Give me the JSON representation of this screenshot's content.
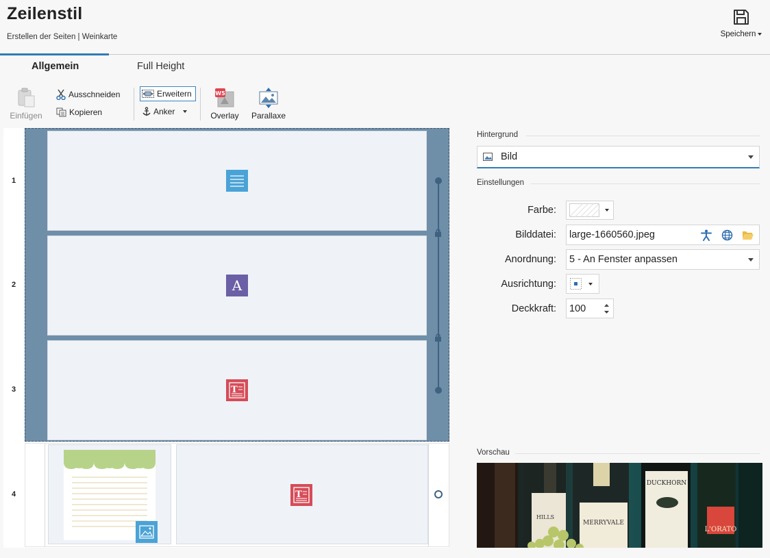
{
  "header": {
    "title": "Zeilenstil",
    "breadcrumb": "Erstellen der Seiten | Weinkarte",
    "save_label": "Speichern"
  },
  "tabs": [
    {
      "label": "Allgemein",
      "active": true
    },
    {
      "label": "Full Height",
      "active": false
    }
  ],
  "ribbon": {
    "paste": "Einfügen",
    "cut": "Ausschneiden",
    "copy": "Kopieren",
    "expand": "Erweitern",
    "anchor": "Anker",
    "overlay": "Overlay",
    "parallax": "Parallaxe"
  },
  "grid": {
    "rows": [
      {
        "number": "1",
        "content": "text-block"
      },
      {
        "number": "2",
        "content": "typography"
      },
      {
        "number": "3",
        "content": "text-image"
      },
      {
        "number": "4",
        "content": "image + text-image"
      }
    ],
    "typography_glyph": "A"
  },
  "panel": {
    "background_section": "Hintergrund",
    "background_type": "Bild",
    "settings_section": "Einstellungen",
    "color_label": "Farbe:",
    "image_label": "Bilddatei:",
    "image_value": "large-1660560.jpeg",
    "arrangement_label": "Anordnung:",
    "arrangement_value": "5 - An Fenster anpassen",
    "alignment_label": "Ausrichtung:",
    "opacity_label": "Deckkraft:",
    "opacity_value": "100",
    "preview_section": "Vorschau",
    "bottle_labels": [
      "HILLS",
      "MERRYVALE",
      "DUCKHORN",
      "L'ORATO"
    ]
  },
  "colors": {
    "accent": "#2f7cb6",
    "row_selection": "#6f8ea8",
    "cell_bg": "#eff3f7",
    "icon_blue": "#4aa3d6",
    "icon_purple": "#6b5fa6",
    "icon_red": "#d64b58"
  }
}
